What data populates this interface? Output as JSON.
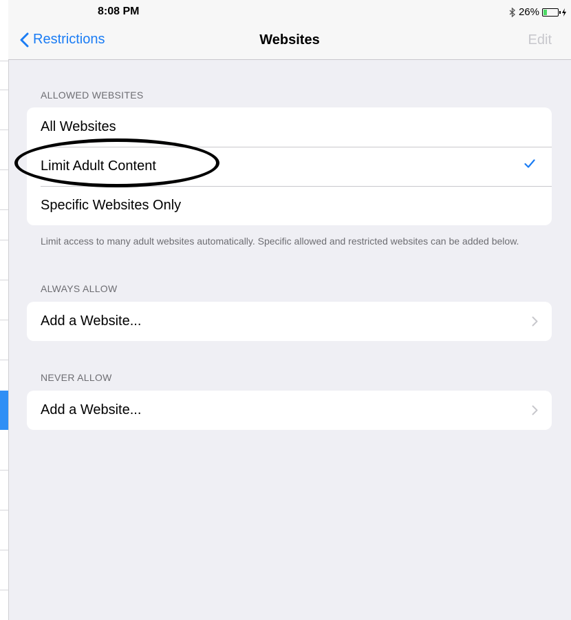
{
  "status_bar": {
    "time": "8:08 PM",
    "bluetooth_icon": "bluetooth-icon",
    "battery": "26%",
    "battery_level": 0.26,
    "charging_icon": "bolt-icon"
  },
  "nav": {
    "back_label": "Restrictions",
    "title": "Websites",
    "edit_label": "Edit"
  },
  "allowed_websites": {
    "header": "ALLOWED WEBSITES",
    "options": [
      "All Websites",
      "Limit Adult Content",
      "Specific Websites Only"
    ],
    "selected": "Limit Adult Content",
    "footer": "Limit access to many adult websites automatically. Specific allowed and restricted websites can be added below."
  },
  "always_allow": {
    "header": "ALWAYS ALLOW",
    "add_label": "Add a Website..."
  },
  "never_allow": {
    "header": "NEVER ALLOW",
    "add_label": "Add a Website..."
  },
  "colors": {
    "accent": "#1a7cf4",
    "background": "#efeff4",
    "annotation": "#000000"
  }
}
